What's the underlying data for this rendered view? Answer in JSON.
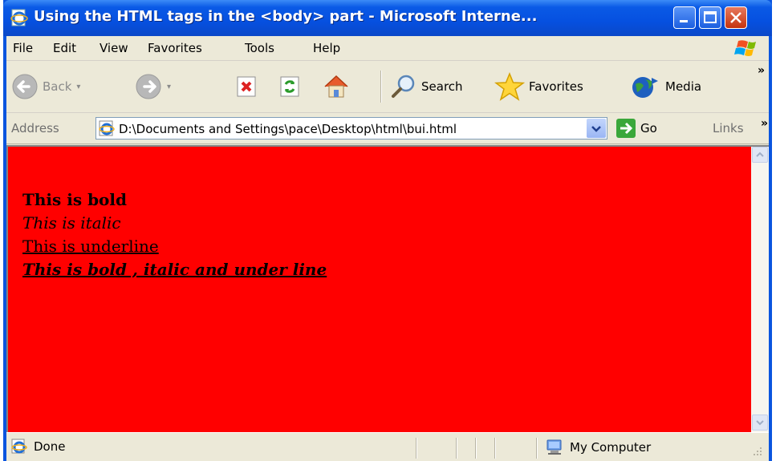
{
  "window": {
    "title": "Using the HTML tags in the <body> part - Microsoft Interne...",
    "title_color": "#0a55df"
  },
  "menu": {
    "items": [
      "File",
      "Edit",
      "View",
      "Favorites",
      "Tools",
      "Help"
    ]
  },
  "toolbar": {
    "back_label": "Back",
    "search_label": "Search",
    "favorites_label": "Favorites",
    "media_label": "Media",
    "more_symbol": "»"
  },
  "address": {
    "label": "Address",
    "value": "D:\\Documents and Settings\\pace\\Desktop\\html\\bui.html",
    "go_label": "Go",
    "links_label": "Links",
    "more_symbol": "»"
  },
  "page": {
    "background": "#ff0000",
    "lines": [
      "This is bold",
      "This is italic",
      "This is underline",
      "This is bold , italic and under line"
    ]
  },
  "status": {
    "text": "Done",
    "zone": "My Computer"
  },
  "icons": {
    "ie_page": "ie-page-icon",
    "minimize": "minimize-icon",
    "maximize": "maximize-icon",
    "close": "close-icon",
    "back": "back-arrow-icon",
    "forward": "forward-arrow-icon",
    "stop": "stop-icon",
    "refresh": "refresh-icon",
    "home": "home-icon",
    "search": "search-icon",
    "favorites": "star-icon",
    "media": "media-icon",
    "go": "go-arrow-icon",
    "computer": "computer-icon",
    "xp_logo": "windows-logo-icon"
  }
}
